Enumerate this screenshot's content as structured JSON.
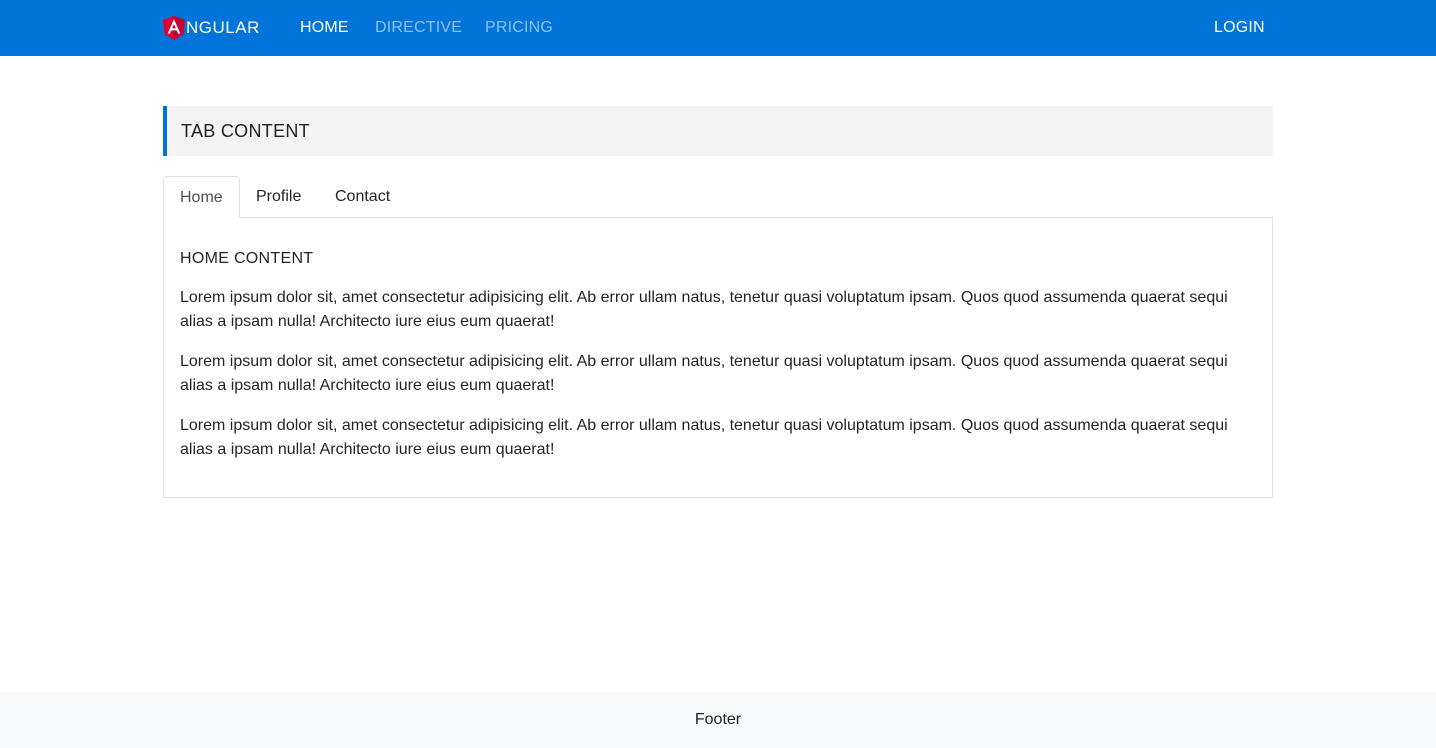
{
  "navbar": {
    "brand_text": "NGULAR",
    "links": [
      {
        "label": "HOME",
        "state": "active"
      },
      {
        "label": "DIRECTIVE",
        "state": "inactive"
      },
      {
        "label": "PRICING",
        "state": "inactive"
      }
    ],
    "login_label": "LOGIN",
    "background_color": "#0074d9",
    "logo_color": "#dd0031"
  },
  "section": {
    "title": "TAB CONTENT"
  },
  "tabs": [
    {
      "label": "Home",
      "active": true
    },
    {
      "label": "Profile",
      "active": false
    },
    {
      "label": "Contact",
      "active": false
    }
  ],
  "panel": {
    "title": "HOME CONTENT",
    "paragraphs": [
      "Lorem ipsum dolor sit, amet consectetur adipisicing elit. Ab error ullam natus, tenetur quasi voluptatum ipsam. Quos quod assumenda quaerat sequi alias a ipsam nulla! Architecto iure eius eum quaerat!",
      "Lorem ipsum dolor sit, amet consectetur adipisicing elit. Ab error ullam natus, tenetur quasi voluptatum ipsam. Quos quod assumenda quaerat sequi alias a ipsam nulla! Architecto iure eius eum quaerat!",
      "Lorem ipsum dolor sit, amet consectetur adipisicing elit. Ab error ullam natus, tenetur quasi voluptatum ipsam. Quos quod assumenda quaerat sequi alias a ipsam nulla! Architecto iure eius eum quaerat!"
    ]
  },
  "footer": {
    "text": "Footer"
  }
}
